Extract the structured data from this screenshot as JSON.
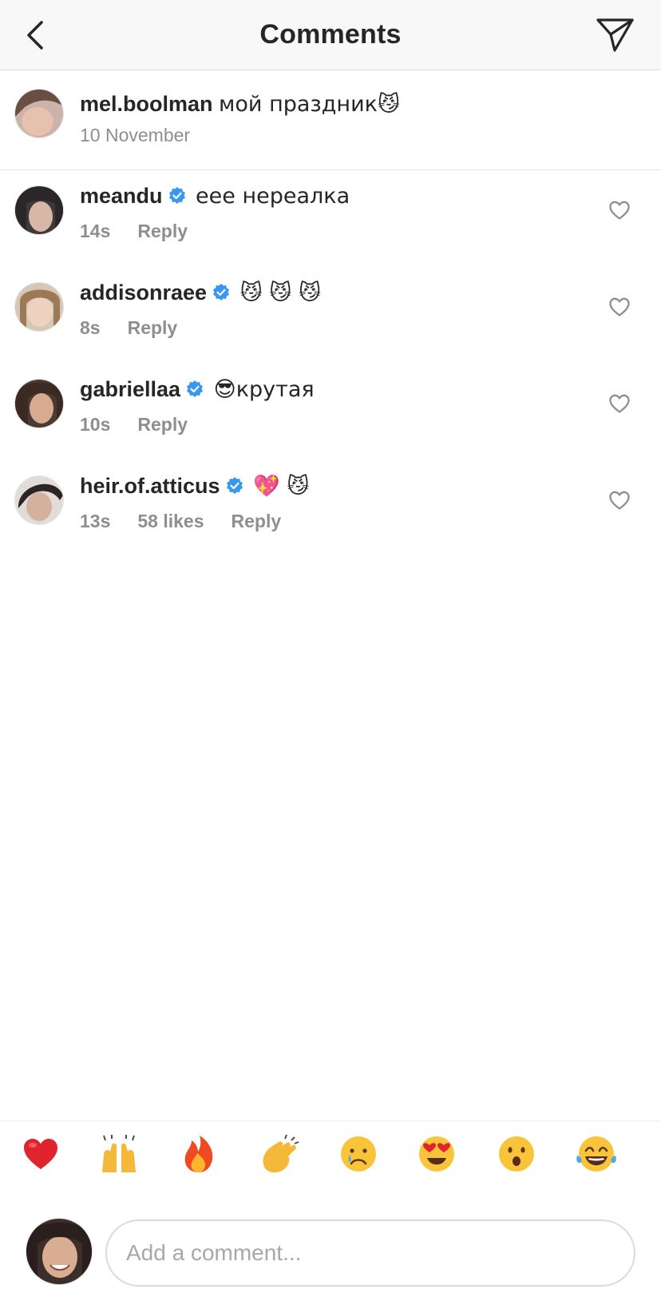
{
  "header": {
    "title": "Comments"
  },
  "caption": {
    "username": "mel.boolman",
    "text": "мой праздник😼",
    "date": "10 November"
  },
  "comments": [
    {
      "username": "meandu",
      "verified": true,
      "text": "еее нереалка",
      "time": "14s",
      "likes": "",
      "reply": "Reply"
    },
    {
      "username": "addisonraee",
      "verified": true,
      "text": "😼 😼 😼",
      "time": "8s",
      "likes": "",
      "reply": "Reply"
    },
    {
      "username": "gabriellaa",
      "verified": true,
      "text": "😎крутая",
      "time": "10s",
      "likes": "",
      "reply": "Reply"
    },
    {
      "username": "heir.of.atticus",
      "verified": true,
      "text": "💖 😼",
      "time": "13s",
      "likes": "58 likes",
      "reply": "Reply"
    }
  ],
  "reactions": [
    "heart",
    "raising-hands",
    "fire",
    "clapping-hands",
    "crying-face",
    "heart-eyes",
    "surprised-face",
    "tears-of-joy"
  ],
  "composer": {
    "placeholder": "Add a comment..."
  },
  "colors": {
    "verified": "#3897f0",
    "meta": "#8e8e8e",
    "text": "#262626",
    "header_bg": "#f8f8f9"
  }
}
